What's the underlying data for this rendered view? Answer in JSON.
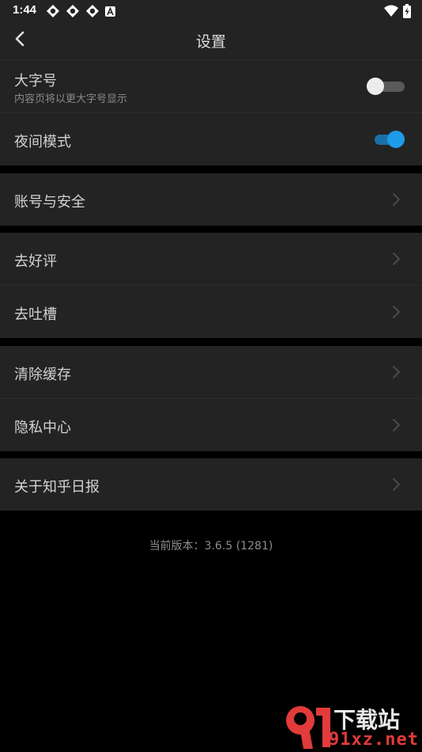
{
  "status_bar": {
    "time": "1:44",
    "left_icons": [
      "notification-icon",
      "notification-icon",
      "notification-icon",
      "font-a-icon"
    ],
    "right_icons": [
      "wifi-icon",
      "battery-charging-icon"
    ]
  },
  "app_bar": {
    "title": "设置",
    "back_icon": "chevron-left-icon"
  },
  "settings": {
    "large_font": {
      "label": "大字号",
      "sublabel": "内容页将以更大字号显示",
      "enabled": false
    },
    "night_mode": {
      "label": "夜间模式",
      "enabled": true
    },
    "account_security": {
      "label": "账号与安全"
    },
    "rate_app": {
      "label": "去好评"
    },
    "feedback": {
      "label": "去吐槽"
    },
    "clear_cache": {
      "label": "清除缓存"
    },
    "privacy_center": {
      "label": "隐私中心"
    },
    "about": {
      "label": "关于知乎日报"
    }
  },
  "footer": {
    "version": "当前版本：3.6.5 (1281)"
  },
  "watermark": {
    "top_text": "下载站",
    "bottom_text": "91xz.net"
  },
  "colors": {
    "background": "#000000",
    "surface": "#232323",
    "accent": "#1e9be9",
    "watermark_red": "#e23b3b"
  }
}
